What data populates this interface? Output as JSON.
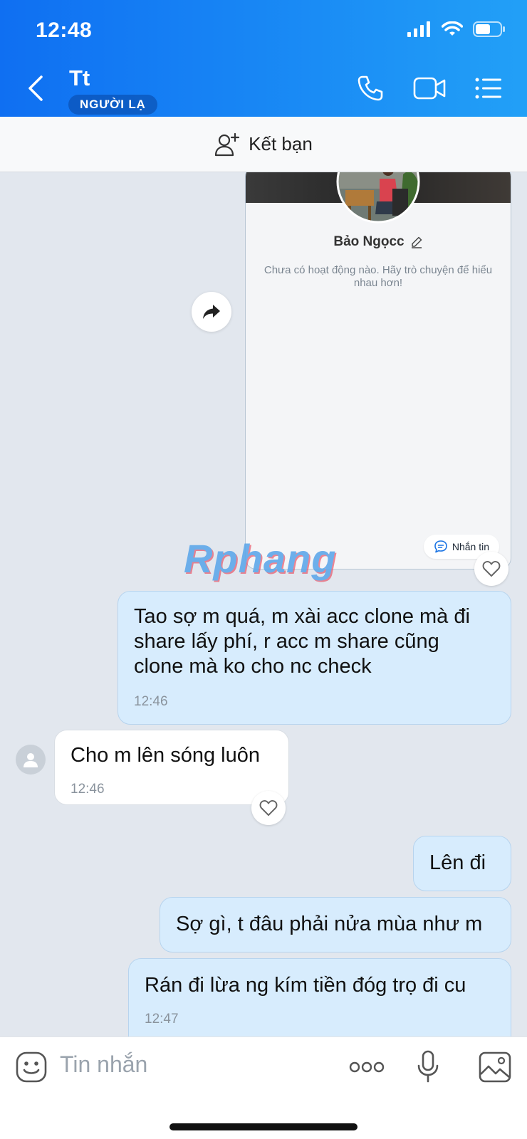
{
  "status_bar": {
    "time": "12:48"
  },
  "header": {
    "contact_name": "Tt",
    "badge": "NGƯỜI LẠ"
  },
  "add_friend": {
    "label": "Kết bạn"
  },
  "profile_card": {
    "name": "Bảo Ngọcc",
    "description": "Chưa có hoạt động nào. Hãy trò chuyện để hiểu nhau hơn!",
    "message_button": "Nhắn tin"
  },
  "watermark": "Rphang",
  "messages": [
    {
      "id": "m1",
      "direction": "outgoing",
      "lines": [
        "Tao sợ m quá, m xài acc clone mà đi",
        "share lấy phí, r acc m share cũng",
        "clone mà ko cho nc check"
      ],
      "time": "12:46"
    },
    {
      "id": "m2",
      "direction": "incoming",
      "text": "Cho m lên sóng luôn",
      "time": "12:46"
    },
    {
      "id": "m3",
      "direction": "outgoing",
      "text": "Lên đi"
    },
    {
      "id": "m4",
      "direction": "outgoing",
      "text": "Sợ gì, t đâu phải nửa mùa như m"
    },
    {
      "id": "m5",
      "direction": "outgoing",
      "text": "Rán đi lừa ng kím tiền đóg trọ đi cu",
      "time": "12:47"
    }
  ],
  "input": {
    "placeholder": "Tin nhắn"
  },
  "colors": {
    "header_start": "#0f6ff2",
    "header_end": "#22a0f7",
    "outgoing_bubble": "#d7ecfd",
    "incoming_bubble": "#ffffff"
  },
  "icons": [
    "back-icon",
    "phone-icon",
    "video-call-icon",
    "menu-list-icon",
    "add-friend-icon",
    "share-forward-icon",
    "heart-icon",
    "sticker-icon",
    "more-icon",
    "microphone-icon",
    "image-icon"
  ]
}
